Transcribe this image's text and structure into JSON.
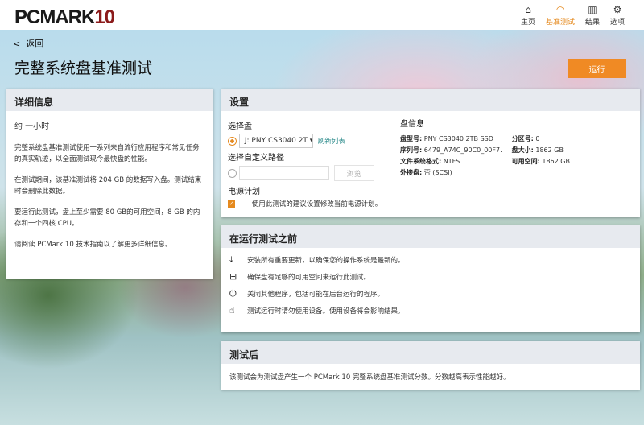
{
  "app": {
    "logo": "PCMARK",
    "logo_num": "10"
  },
  "nav": [
    {
      "label": "主页",
      "icon": "home-icon"
    },
    {
      "label": "基准测试",
      "icon": "gauge-icon"
    },
    {
      "label": "结果",
      "icon": "bar-chart-icon"
    },
    {
      "label": "选项",
      "icon": "gear-icon"
    }
  ],
  "back": "返回",
  "title": "完整系统盘基准测试",
  "run": "运行",
  "details": {
    "title": "详细信息",
    "duration": "约 一小时",
    "paragraphs": [
      "完整系统盘基准测试使用一系列来自流行应用程序和常见任务的真实轨迹，以全面测试现今最快盘的性能。",
      "在测试期间，该基准测试将 204 GB 的数据写入盘。测试结束时会删除此数据。",
      "要运行此测试，盘上至少需要 80 GB的可用空间，8 GB 的内存和一个四核 CPU。",
      "请阅读 PCMark 10 技术指南以了解更多详细信息。"
    ]
  },
  "settings": {
    "title": "设置",
    "select_drive": "选择盘",
    "drive_value": "J: PNY CS3040 2T",
    "refresh": "刷新列表",
    "custom_path": "选择自定义路径",
    "custom_path_value": "",
    "browse": "浏览",
    "power_plan": "电源计划",
    "power_check": "使用此测试的建议设置修改当前电源计划。",
    "info_title": "盘信息",
    "info": [
      {
        "k": "盘型号:",
        "v": "PNY CS3040 2TB SSD"
      },
      {
        "k": "序列号:",
        "v": "6479_A74C_90C0_00F7."
      },
      {
        "k": "文件系统格式:",
        "v": "NTFS"
      },
      {
        "k": "外接盘:",
        "v": "否 (SCSI)"
      }
    ],
    "info2": [
      {
        "k": "分区号:",
        "v": "0"
      },
      {
        "k": "盘大小:",
        "v": "1862 GB"
      },
      {
        "k": "可用空间:",
        "v": "1862 GB"
      }
    ]
  },
  "before": {
    "title": "在运行测试之前",
    "items": [
      "安装所有重要更新，以确保您的操作系统是最新的。",
      "确保盘有足够的可用空间来运行此测试。",
      "关闭其他程序，包括可能在后台运行的程序。",
      "测试运行时请勿使用设备。使用设备将会影响结果。"
    ]
  },
  "after": {
    "title": "测试后",
    "text": "该测试会为测试盘产生一个 PCMark 10 完整系统盘基准测试分数。分数越高表示性能越好。"
  }
}
